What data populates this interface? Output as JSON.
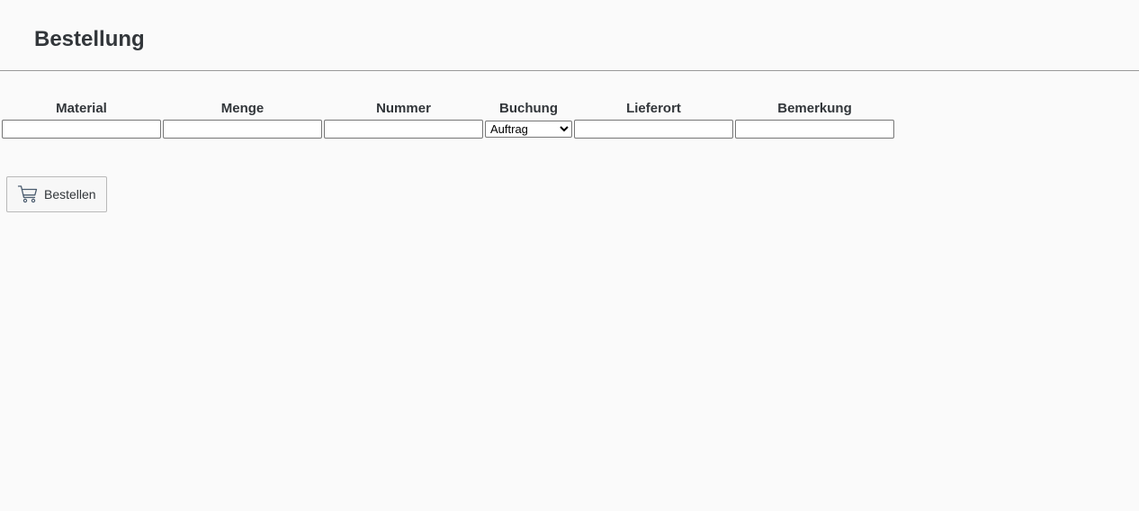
{
  "header": {
    "title": "Bestellung"
  },
  "form": {
    "columns": {
      "material": "Material",
      "menge": "Menge",
      "nummer": "Nummer",
      "buchung": "Buchung",
      "lieferort": "Lieferort",
      "bemerkung": "Bemerkung"
    },
    "values": {
      "material": "",
      "menge": "",
      "nummer": "",
      "lieferort": "",
      "bemerkung": ""
    },
    "buchung_selected": "Auftrag"
  },
  "actions": {
    "order_label": "Bestellen",
    "order_icon": "cart-icon"
  }
}
